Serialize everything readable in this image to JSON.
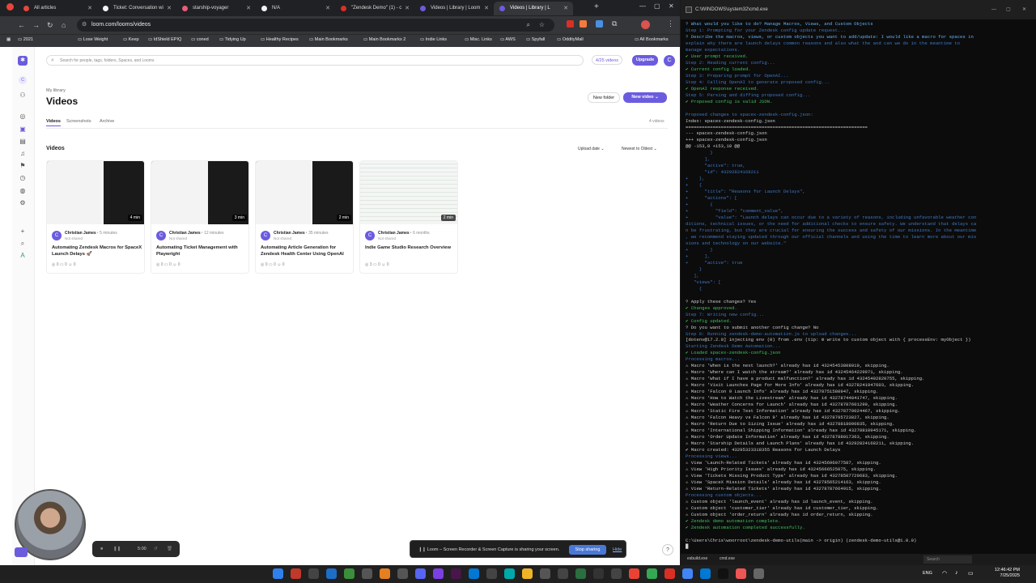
{
  "chrome": {
    "tabs": [
      {
        "label": "All articles",
        "color": "#e4473b"
      },
      {
        "label": "Ticket: Conversation wi",
        "color": "#f1f3f4"
      },
      {
        "label": "starship-voyager",
        "color": "#e85c7d"
      },
      {
        "label": "N/A",
        "color": "#f1f3f4"
      },
      {
        "label": "\"Zendesk Demo\" (1) - c",
        "color": "#d93025"
      },
      {
        "label": "Videos | Library | Loom",
        "color": "#6b5cde"
      },
      {
        "label": "Videos | Library | L",
        "color": "#6b5cde"
      }
    ],
    "url": "loom.com/looms/videos",
    "bookmarks": [
      "2021",
      "Lose Weight",
      "Keep",
      "IdShield EPIQ",
      "coned",
      "Tidying Up",
      "Healthy Recipes",
      "Main Bookmarks",
      "Main Bookmarks 2",
      "Indie Links",
      "Misc. Links",
      "AWS",
      "Spyfall",
      "OddityMall",
      "All Bookmarks"
    ]
  },
  "loom": {
    "search_placeholder": "Search for people, tags, folders, Spaces, and Looms",
    "video_count": "4/25 videos",
    "upgrade": "Upgrade",
    "avatar_letter": "C",
    "breadcrumb": "My library",
    "title": "Videos",
    "new_folder": "New folder",
    "new_video": "New video",
    "tabs": [
      "Videos",
      "Screenshots",
      "Archive"
    ],
    "total": "4 videos",
    "section": "Videos",
    "sort1": "Upload date",
    "sort2": "Newest to Oldest",
    "cards": [
      {
        "author": "Christian James",
        "time": "5 minutes",
        "shared": "Not shared",
        "duration": "4 min",
        "title": "Automating Zendesk Macros for SpaceX Launch Delays 🚀",
        "stats": "◎ 0  ▭ 0  ☺ 0"
      },
      {
        "author": "Christian James",
        "time": "12 minutes",
        "shared": "Not shared",
        "duration": "3 min",
        "title": "Automating Ticket Management with Playwright",
        "stats": "◎ 0  ▭ 0  ☺ 0"
      },
      {
        "author": "Christian James",
        "time": "35 minutes",
        "shared": "Not shared",
        "duration": "2 min",
        "title": "Automating Article Generation for Zendesk Health Center Using OpenAI",
        "stats": "◎ 0  ▭ 0  ☺ 0"
      },
      {
        "author": "Christian James",
        "time": "6 months",
        "shared": "Not shared",
        "duration": "2 min",
        "title": "Indie Game Studio Research Overview",
        "stats": "◎ 3  ▭ 0  ☺ 0"
      }
    ]
  },
  "recorder": {
    "timer": "5:00"
  },
  "share_banner": {
    "text": "Loom – Screen Recorder & Screen Capture is sharing your screen.",
    "stop": "Stop sharing",
    "hide": "Hide"
  },
  "cmd": {
    "title": "C:\\WINDOWS\\system32\\cmd.exe",
    "lines": [
      {
        "t": "? What would you like to do? Manage Macros, Views, and Custom Objects",
        "c": "#5fb3ff"
      },
      {
        "t": "Step 1: Prompting for your Zendesk config update request...",
        "c": "#3a78c9"
      },
      {
        "t": "? Describe the macros, views, or custom objects you want to add/update: I would like a macro for spaces in",
        "c": "#5fb3ff"
      },
      {
        "t": "explain why there are launch delays common reasons and also what the and can we do in the meantime to",
        "c": "#3a78c9"
      },
      {
        "t": "manage expectations.",
        "c": "#3a78c9"
      },
      {
        "t": "✔ User prompt received.",
        "c": "#3bc25c"
      },
      {
        "t": "Step 2: Reading current config...",
        "c": "#3a78c9"
      },
      {
        "t": "✔ Current config loaded.",
        "c": "#3bc25c"
      },
      {
        "t": "Step 3: Preparing prompt for OpenAI...",
        "c": "#3a78c9"
      },
      {
        "t": "Step 4: Calling OpenAI to generate proposed config...",
        "c": "#3a78c9"
      },
      {
        "t": "✔ OpenAI response received.",
        "c": "#3bc25c"
      },
      {
        "t": "Step 5: Parsing and diffing proposed config...",
        "c": "#3a78c9"
      },
      {
        "t": "✔ Proposed config is valid JSON.",
        "c": "#3bc25c"
      },
      {
        "t": "",
        "c": "#ccc"
      },
      {
        "t": "Proposed changes to spacex-zendesk-config.json:",
        "c": "#3a78c9"
      },
      {
        "t": "Index: spacex-zendesk-config.json",
        "c": "#cccccc"
      },
      {
        "t": "===================================================================",
        "c": "#cccccc"
      },
      {
        "t": "--- spacex-zendesk-config.json",
        "c": "#cccccc"
      },
      {
        "t": "+++ spacex-zendesk-config.json",
        "c": "#cccccc"
      },
      {
        "t": "@@ -153,8 +153,18 @@",
        "c": "#cccccc"
      },
      {
        "t": "         }",
        "c": "#3a78c9"
      },
      {
        "t": "       ],",
        "c": "#3a78c9"
      },
      {
        "t": "       \"active\": true,",
        "c": "#3a78c9"
      },
      {
        "t": "       \"id\": 43292824168211",
        "c": "#3a78c9"
      },
      {
        "t": "+    },",
        "c": "#3a78c9"
      },
      {
        "t": "+    {",
        "c": "#3a78c9"
      },
      {
        "t": "+      \"title\": \"Reasons for Launch Delays\",",
        "c": "#3a78c9"
      },
      {
        "t": "+      \"actions\": [",
        "c": "#3a78c9"
      },
      {
        "t": "+        {",
        "c": "#3a78c9"
      },
      {
        "t": "+          \"field\": \"comment_value\",",
        "c": "#3a78c9"
      },
      {
        "t": "+          \"value\": \"Launch delays can occur due to a variety of reasons, including unfavorable weather con",
        "c": "#3a78c9"
      },
      {
        "t": "ditions, technical issues, or the need for additional checks to ensure safety. We understand that delays ca",
        "c": "#3a78c9"
      },
      {
        "t": "n be frustrating, but they are crucial for ensuring the success and safety of our missions. In the meantime",
        "c": "#3a78c9"
      },
      {
        "t": ", we recommend staying updated through our official channels and using the time to learn more about our mis",
        "c": "#3a78c9"
      },
      {
        "t": "sions and technology on our website.\"",
        "c": "#3a78c9"
      },
      {
        "t": "+        }",
        "c": "#3a78c9"
      },
      {
        "t": "+      ],",
        "c": "#3a78c9"
      },
      {
        "t": "+      \"active\": true",
        "c": "#3a78c9"
      },
      {
        "t": "     }",
        "c": "#3a78c9"
      },
      {
        "t": "   ],",
        "c": "#3a78c9"
      },
      {
        "t": "   \"views\": [",
        "c": "#3a78c9"
      },
      {
        "t": "     {",
        "c": "#3a78c9"
      },
      {
        "t": "",
        "c": "#ccc"
      },
      {
        "t": "? Apply these changes? Yes",
        "c": "#cccccc"
      },
      {
        "t": "✔ Changes approved.",
        "c": "#3bc25c"
      },
      {
        "t": "Step 7: Writing new config...",
        "c": "#3a78c9"
      },
      {
        "t": "✔ Config updated.",
        "c": "#3bc25c"
      },
      {
        "t": "? Do you want to submit another config change? No",
        "c": "#cccccc"
      },
      {
        "t": "Step 8: Running zendesk-demo-automation.js to upload changes...",
        "c": "#3a78c9"
      },
      {
        "t": "[dotenv@17.2.0] injecting env (0) from .env (tip: ⚙ write to custom object with { processEnv: myObject })",
        "c": "#cccccc"
      },
      {
        "t": "Starting Zendesk Demo Automation...",
        "c": "#3a78c9"
      },
      {
        "t": "✔ Loaded spacex-zendesk-config.json",
        "c": "#3bc25c"
      },
      {
        "t": "Processing macros...",
        "c": "#3a78c9"
      },
      {
        "t": "⚠ Macro 'When is the next launch?' already has id 43245453808019, skipping.",
        "c": "#cccccc"
      },
      {
        "t": "⚠ Macro 'Where can I watch the stream?' already has id 43245464229971, skipping.",
        "c": "#cccccc"
      },
      {
        "t": "⚠ Macro 'What if I have a product malfunction?' already has id 43245492820755, skipping.",
        "c": "#cccccc"
      },
      {
        "t": "⚠ Macro 'Visit Launches Page for More Info' already has id 43278241947603, skipping.",
        "c": "#cccccc"
      },
      {
        "t": "⚠ Macro 'Falcon 9 Launch Info' already has id 43278751580947, skipping.",
        "c": "#cccccc"
      },
      {
        "t": "⚠ Macro 'How to Watch the Livestream' already has id 43278744841747, skipping.",
        "c": "#cccccc"
      },
      {
        "t": "⚠ Macro 'Weather Concerns for Launch' already has id 43278787601299, skipping.",
        "c": "#cccccc"
      },
      {
        "t": "⚠ Macro 'Static Fire Test Information' already has id 43278779024467, skipping.",
        "c": "#cccccc"
      },
      {
        "t": "⚠ Macro 'Falcon Heavy vs Falcon 9' already has id 43278795723827, skipping.",
        "c": "#cccccc"
      },
      {
        "t": "⚠ Macro 'Return Due to Sizing Issue' already has id 43278818090835, skipping.",
        "c": "#cccccc"
      },
      {
        "t": "⚠ Macro 'International Shipping Information' already has id 43278810945171, skipping.",
        "c": "#cccccc"
      },
      {
        "t": "⚠ Macro 'Order Update Information' already has id 43278788017363, skipping.",
        "c": "#cccccc"
      },
      {
        "t": "⚠ Macro 'Starship Details and Launch Plans' already has id 43292824168211, skipping.",
        "c": "#cccccc"
      },
      {
        "t": "✔ Macro created: 43295323318355 Reasons for Launch Delays",
        "c": "#cccccc"
      },
      {
        "t": "Processing views...",
        "c": "#3a78c9"
      },
      {
        "t": "⚠ View 'Launch-Related Tickets' already has id 43245696077587, skipping.",
        "c": "#cccccc"
      },
      {
        "t": "⚠ View 'High Priority Issues' already has id 43245666525075, skipping.",
        "c": "#cccccc"
      },
      {
        "t": "⚠ View 'Tickets Missing Product Type' already has id 43278507729683, skipping.",
        "c": "#cccccc"
      },
      {
        "t": "⚠ View 'SpaceX Mission Details' already has id 43278565214163, skipping.",
        "c": "#cccccc"
      },
      {
        "t": "⚠ View 'Return-Related Tickets' already has id 43278787664915, skipping.",
        "c": "#cccccc"
      },
      {
        "t": "Processing custom objects...",
        "c": "#3a78c9"
      },
      {
        "t": "⚠ Custom object 'launch_event' already has id launch_event, skipping.",
        "c": "#cccccc"
      },
      {
        "t": "⚠ Custom object 'customer_tier' already has id customer_tier, skipping.",
        "c": "#cccccc"
      },
      {
        "t": "⚠ Custom object 'order_return' already has id order_return, skipping.",
        "c": "#cccccc"
      },
      {
        "t": "✔ Zendesk demo automation complete.",
        "c": "#3bc25c"
      },
      {
        "t": "✔ Zendesk automation completed successfully.",
        "c": "#3bc25c"
      },
      {
        "t": "",
        "c": "#ccc"
      },
      {
        "t": "C:\\Users\\Chris\\woorroot\\zendesk-demo-utils(main -> origin) (zendesk-demo-utils@1.0.0)",
        "c": "#cccccc"
      },
      {
        "t": "█",
        "c": "#cccccc"
      }
    ],
    "tabs": [
      "esbuild.exe",
      "cmd.exe"
    ],
    "search": "Search"
  },
  "taskbar": {
    "lang": "ENG",
    "time": "12:46:42 PM",
    "date": "7/25/2025"
  }
}
